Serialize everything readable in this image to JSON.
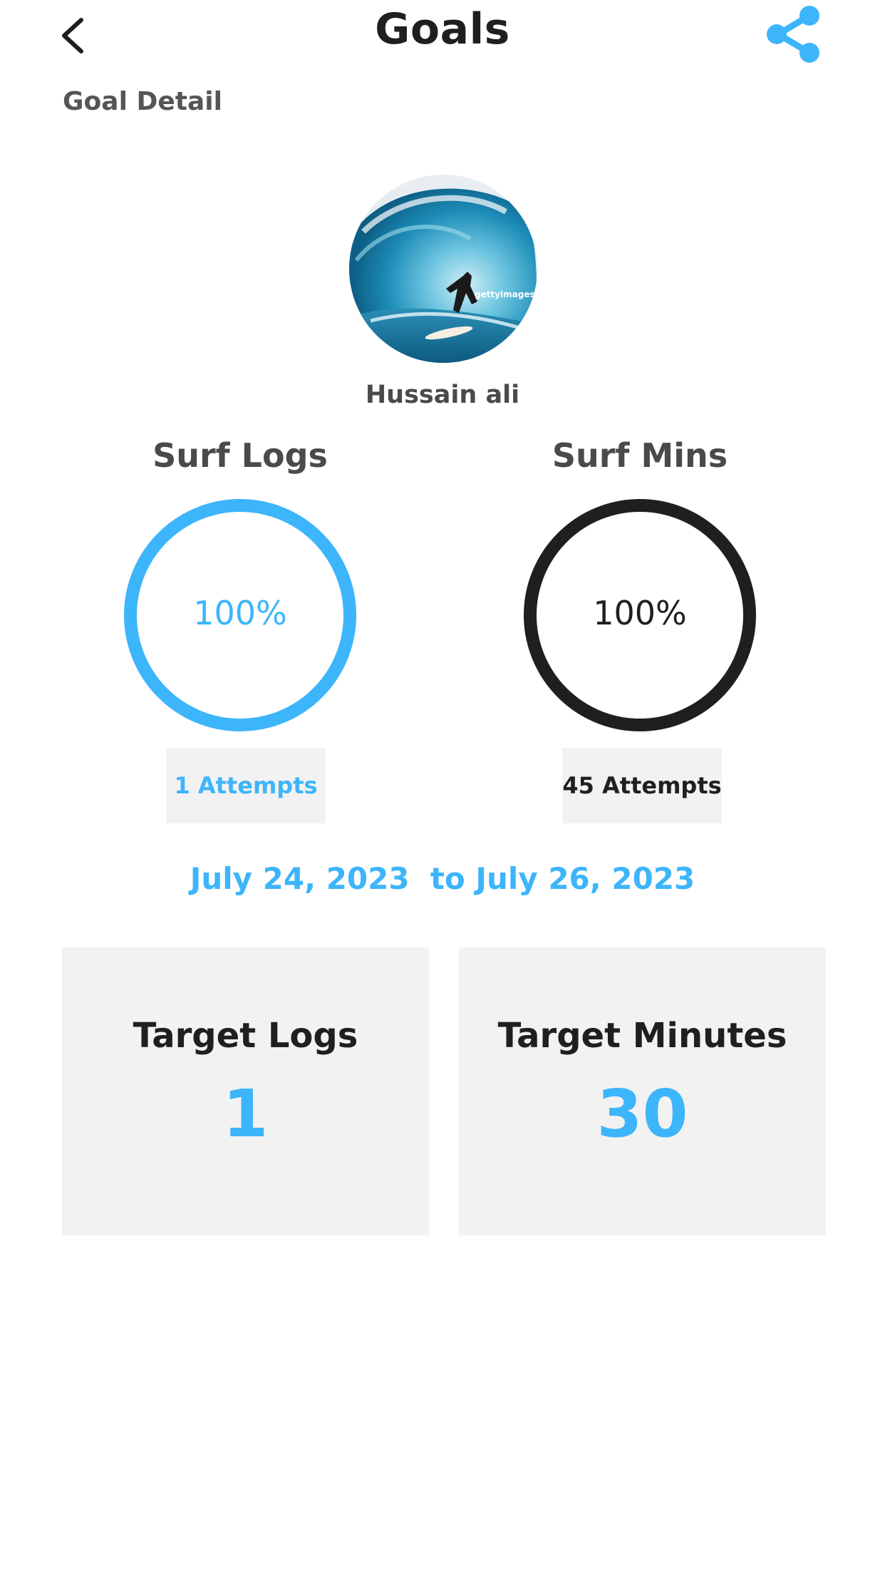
{
  "header": {
    "title": "Goals",
    "subtitle": "Goal Detail",
    "back_icon": "chevron-left-icon",
    "share_icon": "share-icon"
  },
  "profile": {
    "name": "Hussain ali",
    "avatar_watermark": "gettyimages"
  },
  "metrics": [
    {
      "title": "Surf Logs",
      "percent_label": "100%",
      "progress": 1.0,
      "attempts_label": "1 Attempts",
      "color": "#3db5fb"
    },
    {
      "title": "Surf Mins",
      "percent_label": "100%",
      "progress": 1.0,
      "attempts_label": "45 Attempts",
      "color": "#1f1f1f"
    }
  ],
  "date_range": "July 24, 2023  to July 26, 2023",
  "targets": [
    {
      "label": "Target Logs",
      "value": "1"
    },
    {
      "label": "Target Minutes",
      "value": "30"
    }
  ],
  "colors": {
    "accent": "#3db5fb",
    "dark": "#1f1f1f",
    "card_bg": "#f2f2f2"
  }
}
